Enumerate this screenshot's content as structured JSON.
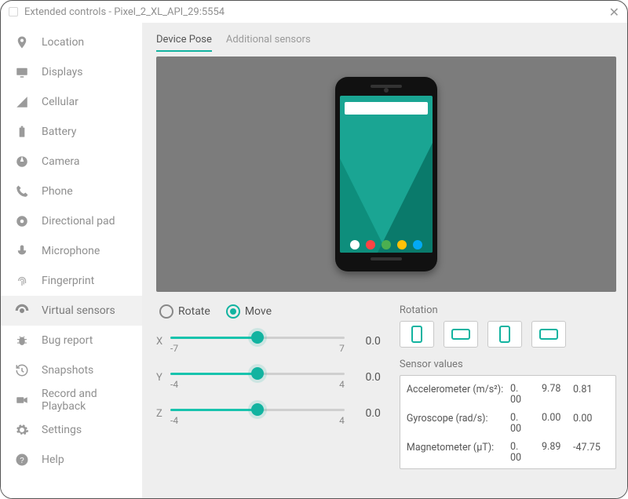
{
  "window": {
    "title": "Extended controls - Pixel_2_XL_API_29:5554"
  },
  "sidebar": {
    "items": [
      {
        "label": "Location"
      },
      {
        "label": "Displays"
      },
      {
        "label": "Cellular"
      },
      {
        "label": "Battery"
      },
      {
        "label": "Camera"
      },
      {
        "label": "Phone"
      },
      {
        "label": "Directional pad"
      },
      {
        "label": "Microphone"
      },
      {
        "label": "Fingerprint"
      },
      {
        "label": "Virtual sensors"
      },
      {
        "label": "Bug report"
      },
      {
        "label": "Snapshots"
      },
      {
        "label": "Record and Playback"
      },
      {
        "label": "Settings"
      },
      {
        "label": "Help"
      }
    ],
    "active_index": 9
  },
  "tabs": {
    "device_pose": "Device Pose",
    "additional_sensors": "Additional sensors",
    "active": "device_pose"
  },
  "mode": {
    "rotate": "Rotate",
    "move": "Move",
    "selected": "move"
  },
  "axes": {
    "x": {
      "label": "X",
      "min": "-7",
      "max": "7",
      "value": "0.0",
      "pos": 0.5
    },
    "y": {
      "label": "Y",
      "min": "-4",
      "max": "4",
      "value": "0.0",
      "pos": 0.5
    },
    "z": {
      "label": "Z",
      "min": "-4",
      "max": "4",
      "value": "0.0",
      "pos": 0.5
    }
  },
  "rotation": {
    "title": "Rotation"
  },
  "sensors": {
    "title": "Sensor values",
    "rows": [
      {
        "name": "Accelerometer (m/s²):",
        "v0": "0.\n00",
        "v1": "9.78",
        "v2": "0.81"
      },
      {
        "name": "Gyroscope (rad/s):",
        "v0": "0.\n00",
        "v1": "0.00",
        "v2": "0.00"
      },
      {
        "name": "Magnetometer (μT):",
        "v0": "0.\n00",
        "v1": "9.89",
        "v2": "-47.75"
      }
    ]
  }
}
